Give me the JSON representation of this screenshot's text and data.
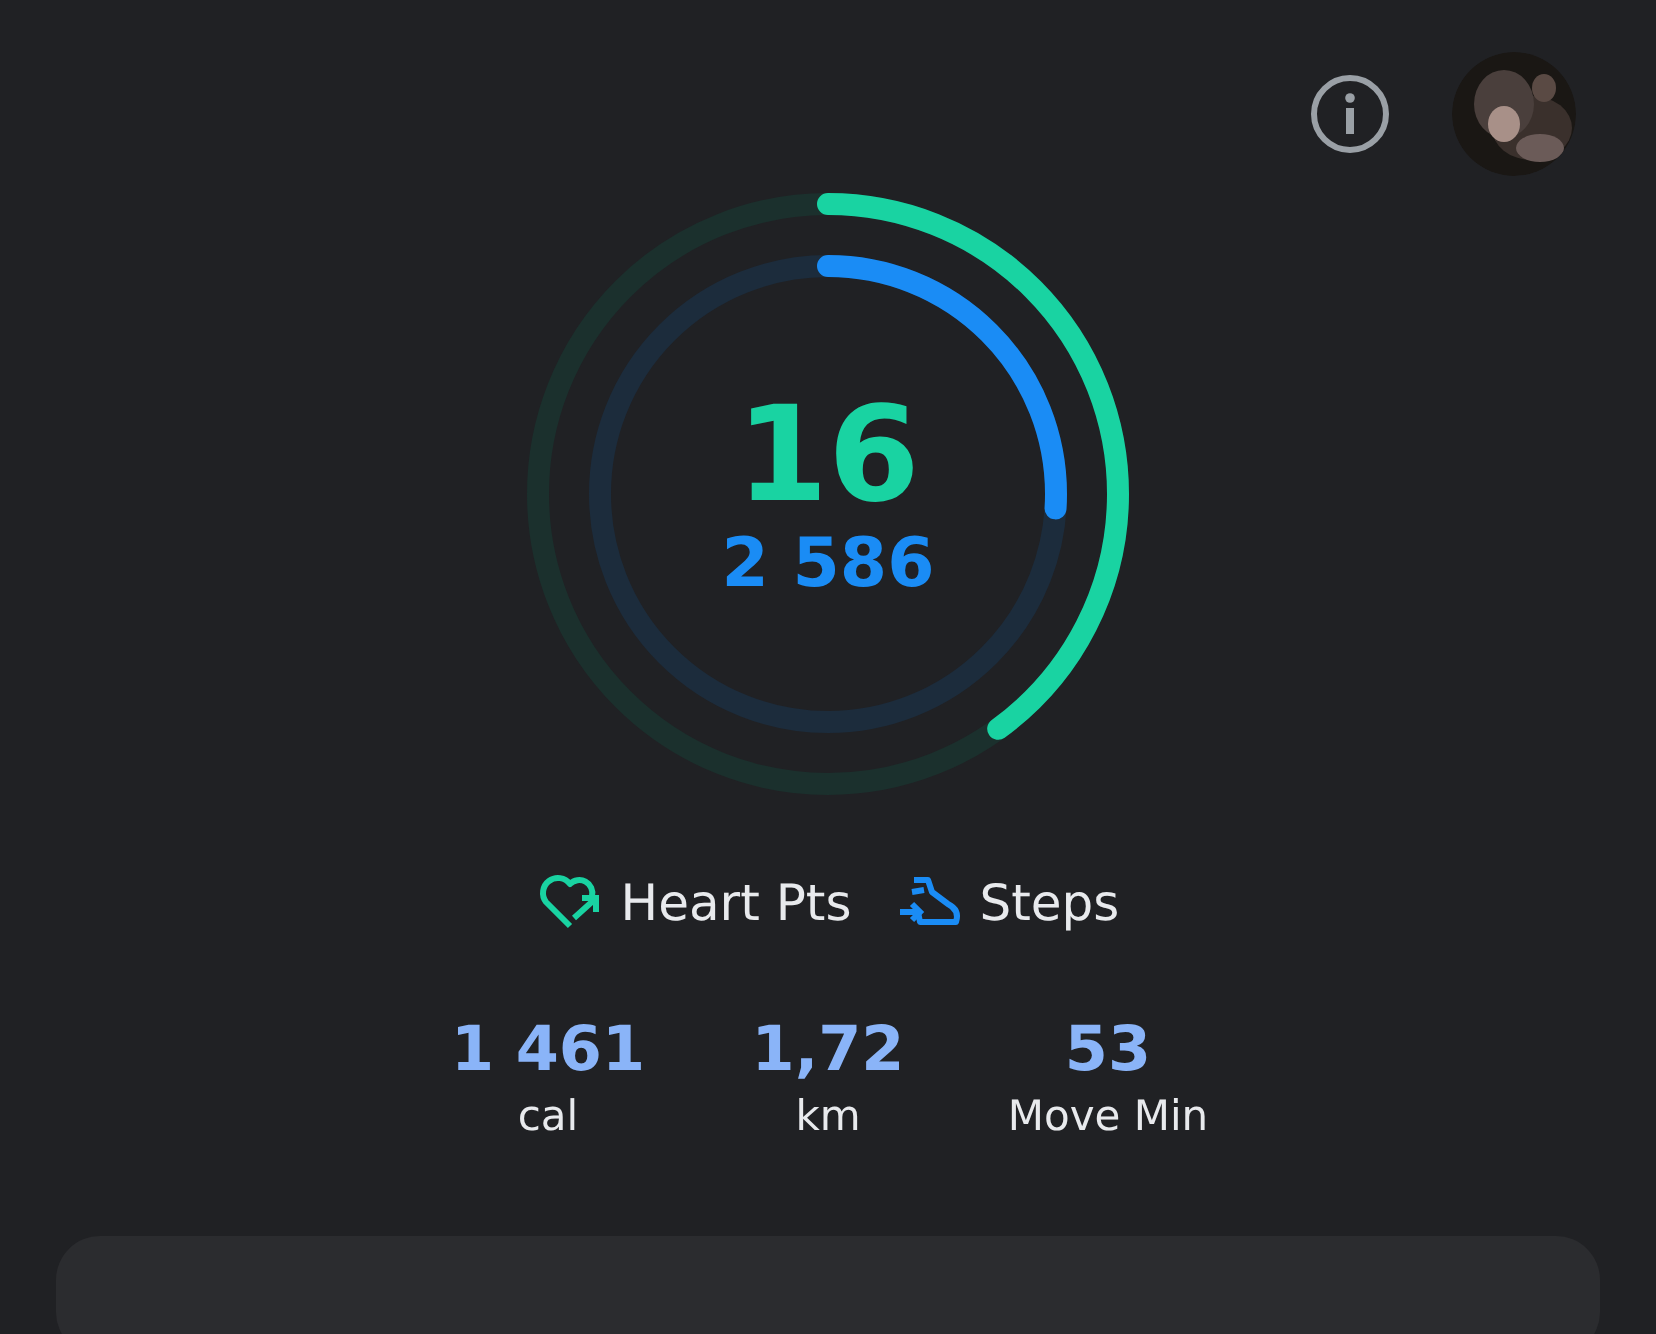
{
  "rings": {
    "heart_points": {
      "value": "16",
      "level": 0.4
    },
    "steps": {
      "value": "2 586",
      "level": 0.26
    }
  },
  "legend": [
    {
      "kind": "heart",
      "label": "Heart Pts"
    },
    {
      "kind": "steps",
      "label": "Steps"
    }
  ],
  "stats": [
    {
      "value": "1 461",
      "unit": "cal"
    },
    {
      "value": "1,72",
      "unit": "km"
    },
    {
      "value": "53",
      "unit": "Move Min"
    }
  ]
}
